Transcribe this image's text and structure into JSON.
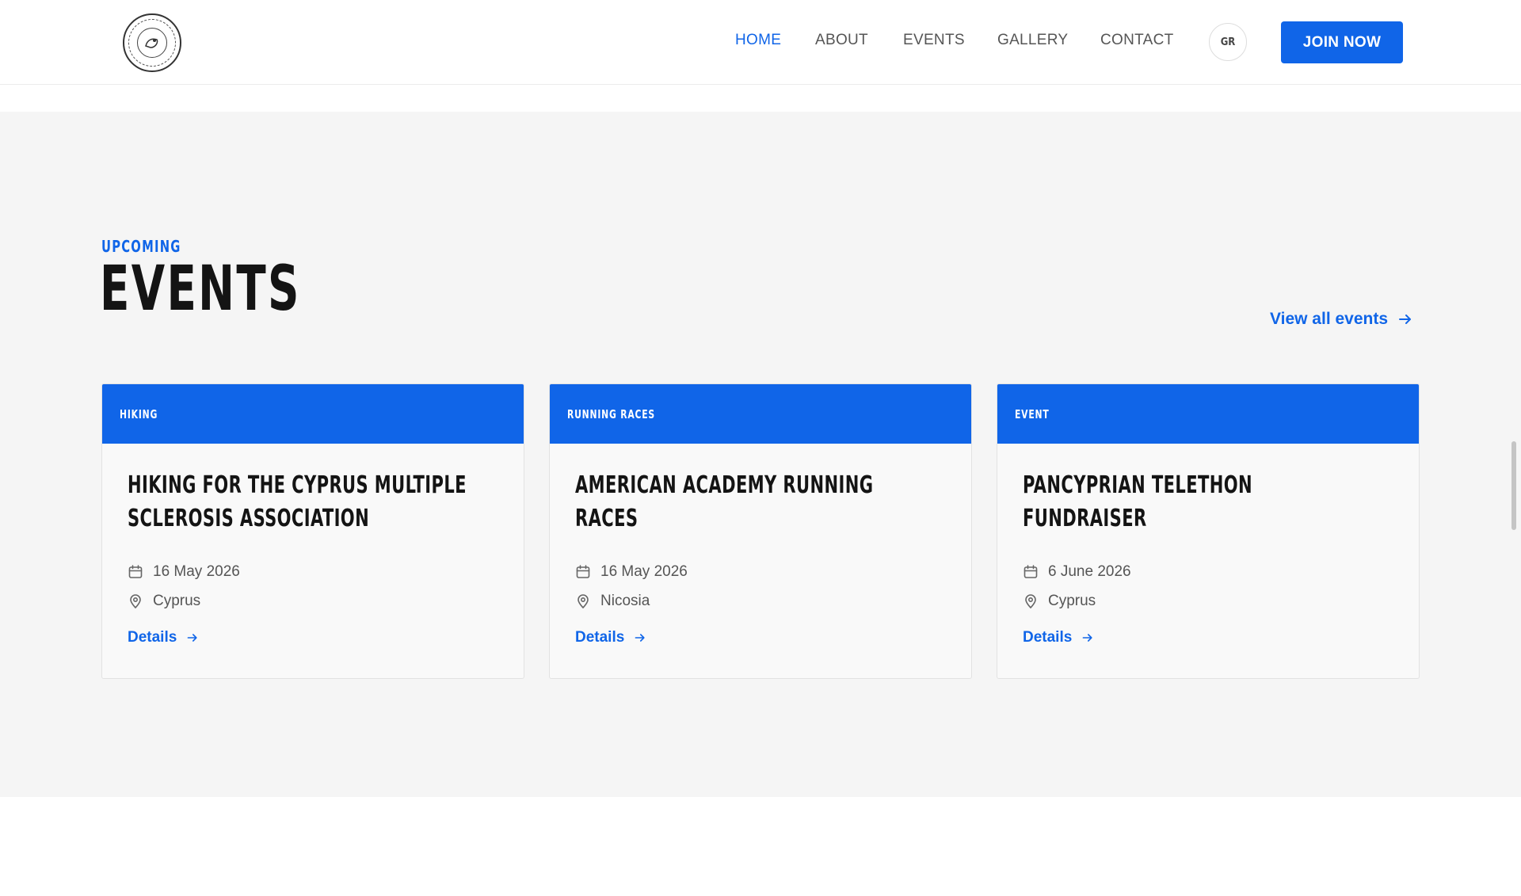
{
  "nav": {
    "items": [
      {
        "label": "HOME",
        "active": true
      },
      {
        "label": "ABOUT",
        "active": false
      },
      {
        "label": "EVENTS",
        "active": false
      },
      {
        "label": "GALLERY",
        "active": false
      },
      {
        "label": "CONTACT",
        "active": false
      }
    ],
    "lang_label": "GR",
    "cta_label": "JOIN NOW"
  },
  "events_section": {
    "eyebrow": "UPCOMING",
    "title": "EVENTS",
    "view_all_label": "View all events",
    "cards": [
      {
        "tag": "HIKING",
        "title": "HIKING FOR THE CYPRUS MULTIPLE SCLEROSIS ASSOCIATION",
        "date": "16 May 2026",
        "location": "Cyprus",
        "details_label": "Details"
      },
      {
        "tag": "RUNNING RACES",
        "title": "AMERICAN ACADEMY RUNNING RACES",
        "date": "16 May 2026",
        "location": "Nicosia",
        "details_label": "Details"
      },
      {
        "tag": "EVENT",
        "title": "PANCYPRIAN TELETHON FUNDRAISER",
        "date": "6 June 2026",
        "location": "Cyprus",
        "details_label": "Details"
      }
    ]
  },
  "colors": {
    "accent": "#1065e8",
    "section_bg": "#f5f5f5",
    "card_bg": "#f9f9f9",
    "heading": "#141414",
    "muted_text": "#555555"
  }
}
